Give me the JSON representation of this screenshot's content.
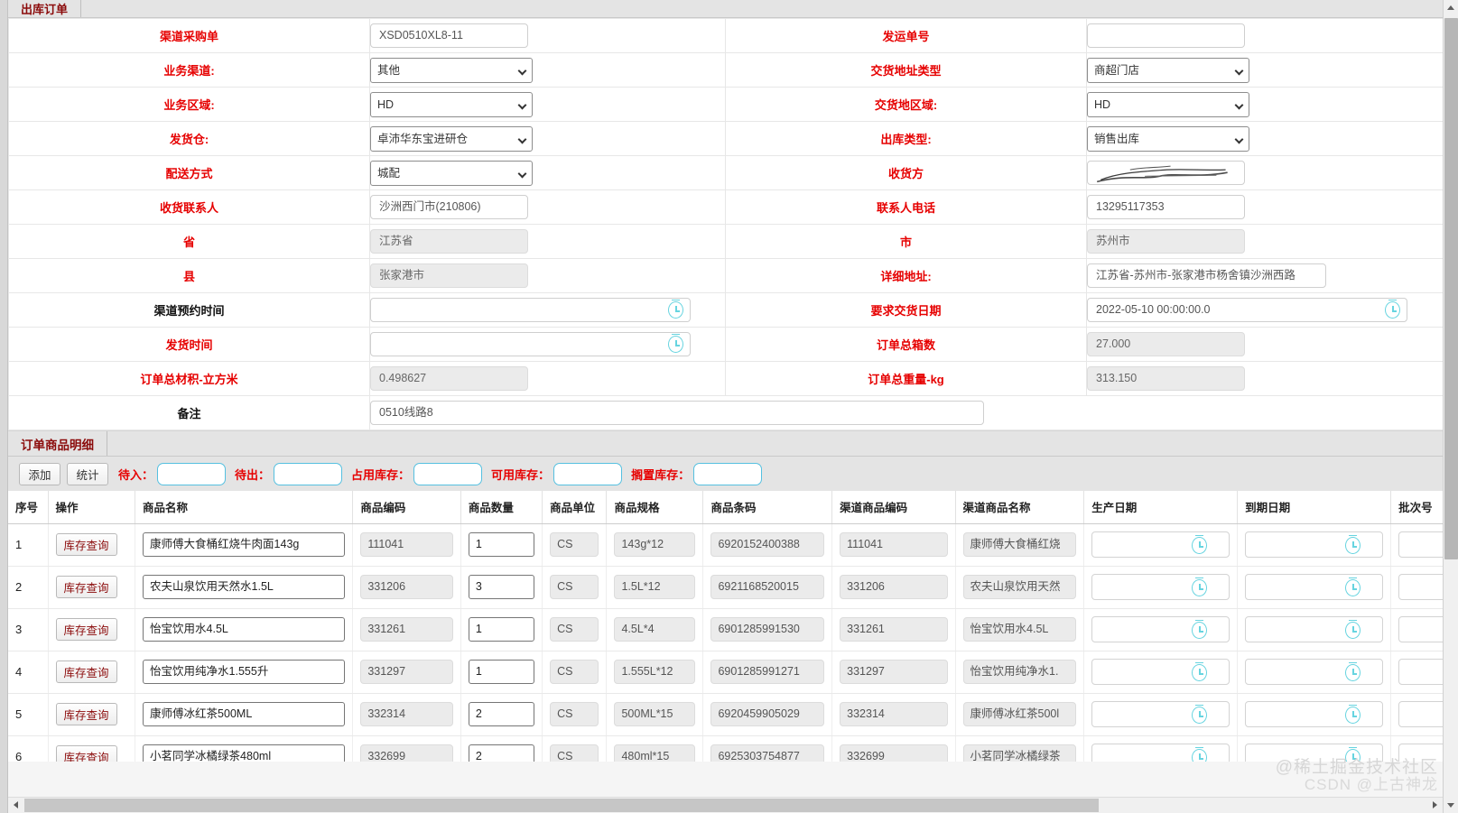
{
  "colors": {
    "required_label": "#e60000",
    "tab_title": "#8b0b0b",
    "clock_icon": "#67d4e0",
    "toolbar_input_border": "#55c0e0"
  },
  "header": {
    "tab_label": "出库订单"
  },
  "form": {
    "rows": [
      {
        "left": {
          "label": "渠道采购单",
          "required": true,
          "type": "text",
          "value": "XSD0510XL8-11"
        },
        "right": {
          "label": "发运单号",
          "required": true,
          "type": "text",
          "value": ""
        }
      },
      {
        "left": {
          "label": "业务渠道:",
          "required": true,
          "type": "select",
          "value": "其他"
        },
        "right": {
          "label": "交货地址类型",
          "required": true,
          "type": "select",
          "value": "商超门店"
        }
      },
      {
        "left": {
          "label": "业务区域:",
          "required": true,
          "type": "select",
          "value": "HD"
        },
        "right": {
          "label": "交货地区域:",
          "required": true,
          "type": "select",
          "value": "HD"
        }
      },
      {
        "left": {
          "label": "发货仓:",
          "required": true,
          "type": "select",
          "value": "卓沛华东宝进研仓"
        },
        "right": {
          "label": "出库类型:",
          "required": true,
          "type": "select",
          "value": "销售出库"
        }
      },
      {
        "left": {
          "label": "配送方式",
          "required": true,
          "type": "select",
          "value": "城配"
        },
        "right": {
          "label": "收货方",
          "required": true,
          "type": "redacted",
          "value": ""
        }
      },
      {
        "left": {
          "label": "收货联系人",
          "required": true,
          "type": "text",
          "value": "沙洲西门市(210806)"
        },
        "right": {
          "label": "联系人电话",
          "required": true,
          "type": "text",
          "value": "13295117353"
        }
      },
      {
        "left": {
          "label": "省",
          "required": true,
          "type": "readonly",
          "value": "江苏省"
        },
        "right": {
          "label": "市",
          "required": true,
          "type": "readonly",
          "value": "苏州市"
        }
      },
      {
        "left": {
          "label": "县",
          "required": true,
          "type": "readonly",
          "value": "张家港市"
        },
        "right": {
          "label": "详细地址:",
          "required": true,
          "type": "text",
          "value": "江苏省-苏州市-张家港市杨舍镇沙洲西路"
        }
      },
      {
        "left": {
          "label": "渠道预约时间",
          "required": false,
          "type": "date",
          "value": ""
        },
        "right": {
          "label": "要求交货日期",
          "required": true,
          "type": "date",
          "value": "2022-05-10 00:00:00.0"
        }
      },
      {
        "left": {
          "label": "发货时间",
          "required": true,
          "type": "date",
          "value": ""
        },
        "right": {
          "label": "订单总箱数",
          "required": true,
          "type": "readonly",
          "value": "27.000"
        }
      },
      {
        "left": {
          "label": "订单总材积-立方米",
          "required": true,
          "type": "readonly",
          "value": "0.498627"
        },
        "right": {
          "label": "订单总重量-kg",
          "required": true,
          "type": "readonly",
          "value": "313.150"
        }
      }
    ],
    "remark": {
      "label": "备注",
      "required": false,
      "value": "0510线路8"
    }
  },
  "detail": {
    "tab_label": "订单商品明细",
    "toolbar": {
      "add_button": "添加",
      "stat_button": "统计",
      "fields": [
        {
          "label": "待入：",
          "value": ""
        },
        {
          "label": "待出：",
          "value": ""
        },
        {
          "label": "占用库存：",
          "value": ""
        },
        {
          "label": "可用库存：",
          "value": ""
        },
        {
          "label": "搁置库存：",
          "value": ""
        }
      ]
    },
    "columns": [
      "序号",
      "操作",
      "商品名称",
      "商品编码",
      "商品数量",
      "商品单位",
      "商品规格",
      "商品条码",
      "渠道商品编码",
      "渠道商品名称",
      "生产日期",
      "到期日期",
      "批次号"
    ],
    "row_action_label": "库存查询",
    "rows": [
      {
        "seq": "1",
        "product_name": "康师傅大食桶红烧牛肉面143g",
        "product_code": "111041",
        "qty": "1",
        "unit": "CS",
        "spec": "143g*12",
        "barcode": "6920152400388",
        "channel_code": "111041",
        "channel_name": "康师傅大食桶红烧",
        "prod_date": "",
        "expiry_date": "",
        "batch_no": ""
      },
      {
        "seq": "2",
        "product_name": "农夫山泉饮用天然水1.5L",
        "product_code": "331206",
        "qty": "3",
        "unit": "CS",
        "spec": "1.5L*12",
        "barcode": "6921168520015",
        "channel_code": "331206",
        "channel_name": "农夫山泉饮用天然",
        "prod_date": "",
        "expiry_date": "",
        "batch_no": ""
      },
      {
        "seq": "3",
        "product_name": "怡宝饮用水4.5L",
        "product_code": "331261",
        "qty": "1",
        "unit": "CS",
        "spec": "4.5L*4",
        "barcode": "6901285991530",
        "channel_code": "331261",
        "channel_name": "怡宝饮用水4.5L",
        "prod_date": "",
        "expiry_date": "",
        "batch_no": ""
      },
      {
        "seq": "4",
        "product_name": "怡宝饮用纯净水1.555升",
        "product_code": "331297",
        "qty": "1",
        "unit": "CS",
        "spec": "1.555L*12",
        "barcode": "6901285991271",
        "channel_code": "331297",
        "channel_name": "怡宝饮用纯净水1.",
        "prod_date": "",
        "expiry_date": "",
        "batch_no": ""
      },
      {
        "seq": "5",
        "product_name": "康师傅冰红茶500ML",
        "product_code": "332314",
        "qty": "2",
        "unit": "CS",
        "spec": "500ML*15",
        "barcode": "6920459905029",
        "channel_code": "332314",
        "channel_name": "康师傅冰红茶500l",
        "prod_date": "",
        "expiry_date": "",
        "batch_no": ""
      },
      {
        "seq": "6",
        "product_name": "小茗同学冰橘绿茶480ml",
        "product_code": "332699",
        "qty": "2",
        "unit": "CS",
        "spec": "480ml*15",
        "barcode": "6925303754877",
        "channel_code": "332699",
        "channel_name": "小茗同学冰橘绿茶",
        "prod_date": "",
        "expiry_date": "",
        "batch_no": ""
      }
    ]
  },
  "watermark": {
    "line1": "@稀土掘金技术社区",
    "line2": "CSDN @上古神龙"
  }
}
